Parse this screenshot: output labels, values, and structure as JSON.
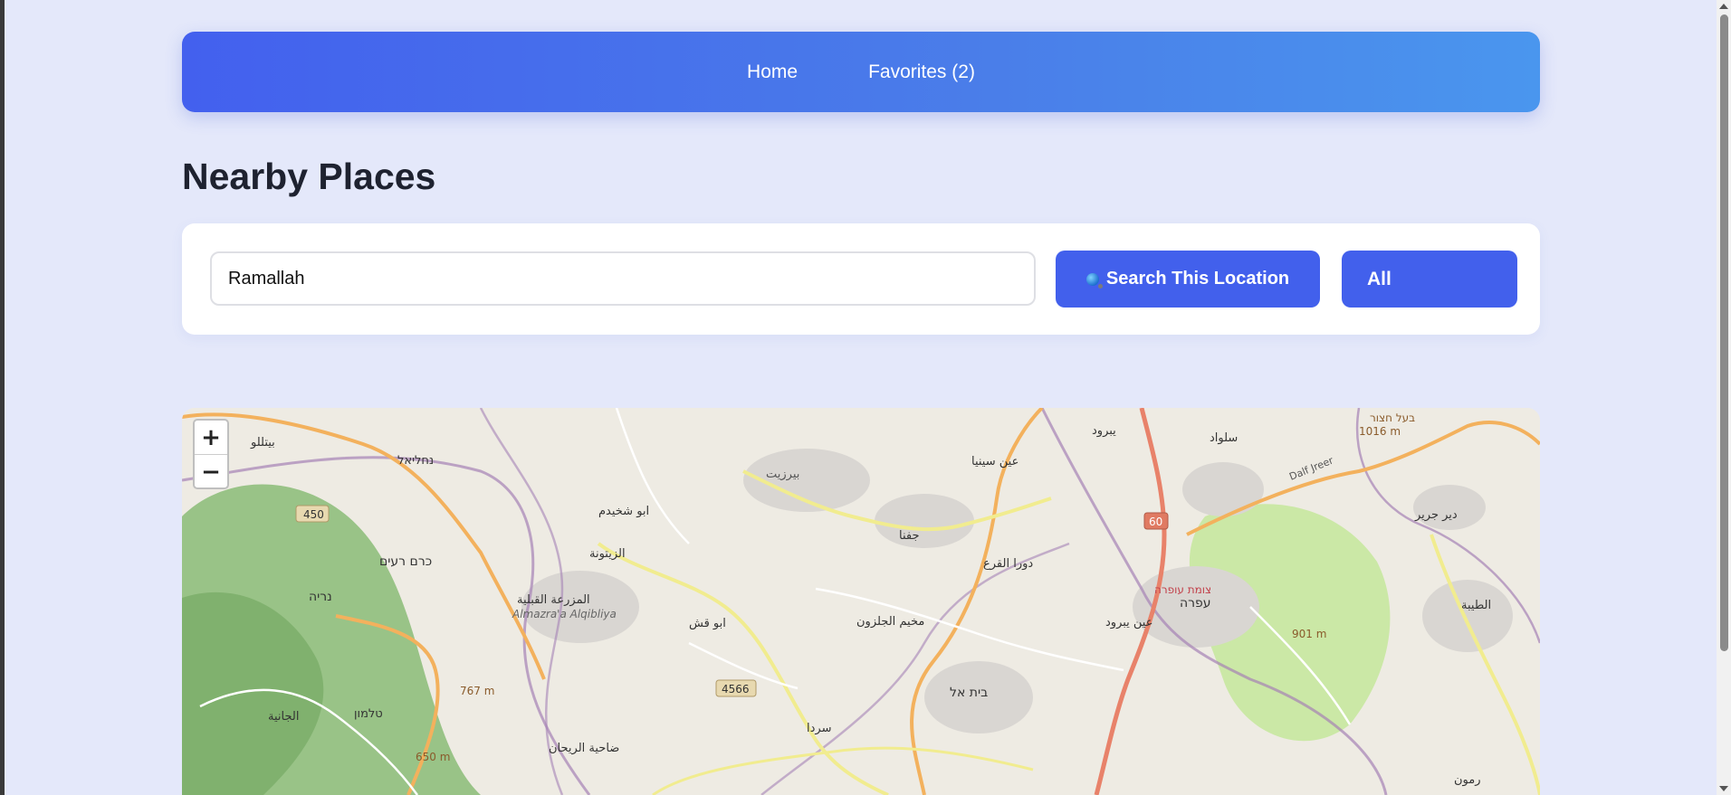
{
  "nav": {
    "home_label": "Home",
    "favorites_label": "Favorites (2)"
  },
  "page": {
    "title": "Nearby Places"
  },
  "search": {
    "value": "Ramallah",
    "button_label": "Search This Location",
    "button_icon": "globe-icon",
    "filter_selected": "All"
  },
  "map": {
    "zoom_in_label": "+",
    "zoom_out_label": "−",
    "labels": [
      "בית אל",
      "נחליאל",
      "כרם רעים",
      "נריה",
      "טלמון",
      "צומת עופרה",
      "עפרה",
      "بيرزيت",
      "ابو شخيدم",
      "الزيتونة",
      "المزرعة القبلية",
      "Almazra'a Alqibliya",
      "ابو قش",
      "مخيم الجلزون",
      "عين سينيا",
      "جفنا",
      "دورا القرع",
      "عين يبرود",
      "سلواد",
      "يبرود",
      "دير جرير",
      "الطيبة",
      "رمون",
      "سردا",
      "ضاحية الريحان",
      "الجانية",
      "بيتللو",
      "בעל חצור",
      "1016 m",
      "901 m",
      "767 m",
      "650 m",
      "450",
      "4566",
      "60",
      "Dalf Jreer"
    ],
    "road_colors": {
      "major": "#e8826a",
      "secondary": "#f3b15d",
      "tertiary": "#f6f6a8",
      "boundary": "#9c7ea8",
      "forest": "#8bbf7a",
      "park": "#cdeba8",
      "urban": "#d8d6d3"
    }
  }
}
